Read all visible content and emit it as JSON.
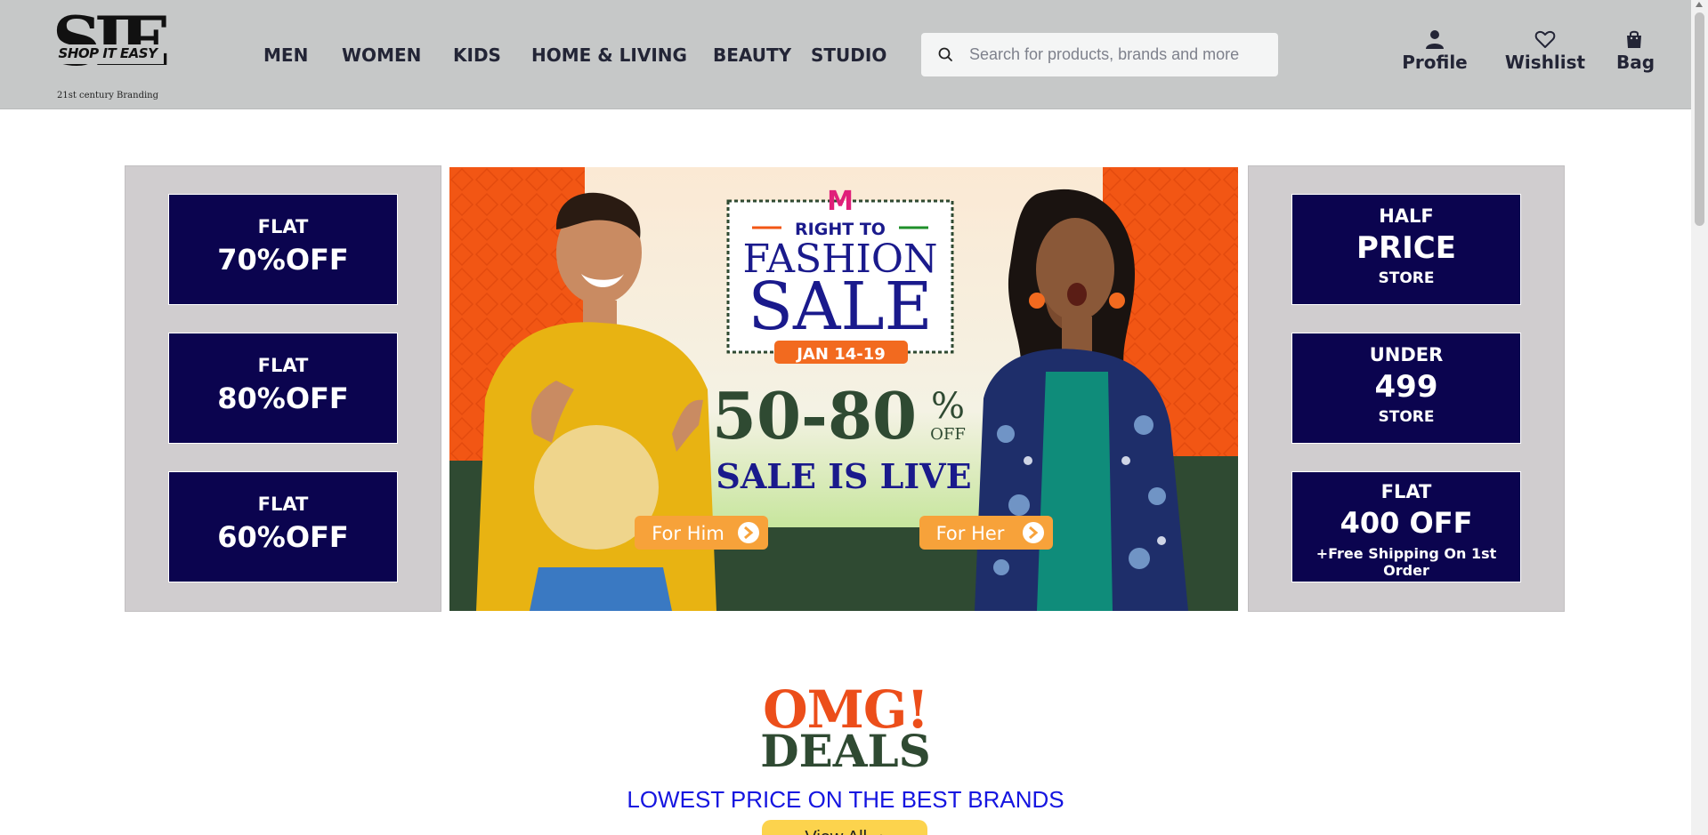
{
  "logo": {
    "big": "SIE",
    "name": "SHOP IT EASY",
    "tagline": "21st century Branding"
  },
  "nav": [
    "MEN",
    "WOMEN",
    "KIDS",
    "HOME & LIVING",
    "BEAUTY",
    "STUDIO"
  ],
  "search": {
    "placeholder": "Search for products, brands and more"
  },
  "header_actions": {
    "profile": "Profile",
    "wishlist": "Wishlist",
    "bag": "Bag"
  },
  "left_offers": [
    {
      "line1": "FLAT",
      "line2": "70%OFF"
    },
    {
      "line1": "FLAT",
      "line2": "80%OFF"
    },
    {
      "line1": "FLAT",
      "line2": "60%OFF"
    }
  ],
  "right_offers": [
    {
      "line1": "HALF",
      "line2": "PRICE",
      "line3": "STORE"
    },
    {
      "line1": "UNDER",
      "line2": "499",
      "line3": "STORE"
    },
    {
      "line1": "FLAT",
      "line2": "400 OFF",
      "line3": "+Free Shipping On 1st Order"
    }
  ],
  "banner": {
    "brand_mark": "M",
    "kicker": "RIGHT TO",
    "title1": "FASHION",
    "title2": "SALE",
    "dates": "JAN 14-19",
    "discount": "50-80",
    "percent": "%",
    "off": "OFF",
    "live": "SALE IS LIVE",
    "cta_him": "For Him",
    "cta_her": "For Her"
  },
  "deals": {
    "title1": "OMG!",
    "title2": "DEALS",
    "subtitle": "LOWEST PRICE ON THE BEST BRANDS",
    "button": "View All"
  },
  "colors": {
    "header_bg": "#c6c8c8",
    "offer_bg": "#0b044f",
    "panel_bg": "#d0cdcf",
    "banner_orange": "#f25614",
    "banner_green": "#2f4a32",
    "deals_orange": "#ec4e1a",
    "deals_blue": "#1515e0",
    "view_all_bg": "#fcd34d"
  },
  "icons": {
    "search": "search-icon",
    "profile": "user-icon",
    "wishlist": "heart-icon",
    "bag": "shopping-bag-icon"
  }
}
